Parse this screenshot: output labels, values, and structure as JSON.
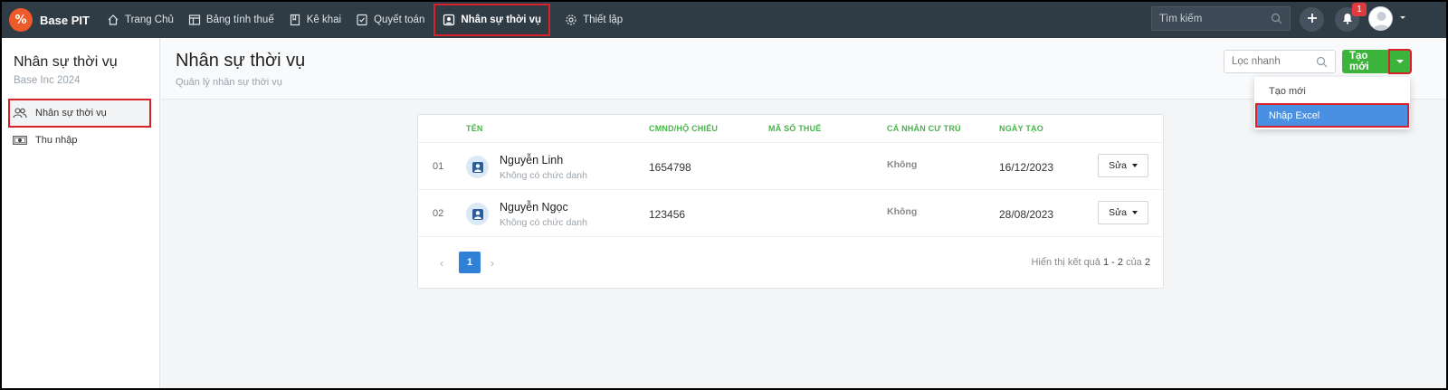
{
  "app": {
    "logo_glyph": "%",
    "name": "Base PIT",
    "brand_color": "#ef5a2a",
    "accent_green": "#3cb43c",
    "highlight_blue": "#4a90e2"
  },
  "nav": {
    "items": [
      {
        "label": "Trang Chủ",
        "icon": "home-icon"
      },
      {
        "label": "Bảng tính thuế",
        "icon": "table-icon"
      },
      {
        "label": "Kê khai",
        "icon": "book-icon"
      },
      {
        "label": "Quyết toán",
        "icon": "checklist-icon"
      },
      {
        "label": "Nhân sự thời vụ",
        "icon": "person-card-icon",
        "active": true
      },
      {
        "label": "Thiết lập",
        "icon": "gear-icon"
      }
    ],
    "search_placeholder": "Tìm kiếm",
    "notification_count": "1"
  },
  "sidebar": {
    "title": "Nhân sự thời vụ",
    "subtitle": "Base Inc 2024",
    "items": [
      {
        "label": "Nhân sự thời vụ",
        "icon": "people-icon",
        "active": true
      },
      {
        "label": "Thu nhập",
        "icon": "money-icon"
      }
    ]
  },
  "header": {
    "title": "Nhân sự thời vụ",
    "subtitle": "Quản lý nhân sự thời vụ",
    "filter_placeholder": "Lọc nhanh",
    "create_label": "Tạo mới"
  },
  "dropdown": {
    "items": [
      "Tạo mới",
      "Nhập Excel"
    ],
    "highlighted": "Nhập Excel"
  },
  "table": {
    "columns": [
      "TÊN",
      "CMND/HỘ CHIẾU",
      "MÃ SỐ THUẾ",
      "CÁ NHÂN CƯ TRÚ",
      "NGÀY TẠO"
    ],
    "rows": [
      {
        "num": "01",
        "name": "Nguyễn Linh",
        "role": "Không có chức danh",
        "id_number": "1654798",
        "tax_code": "",
        "resident": "Không",
        "created": "16/12/2023",
        "action": "Sửa"
      },
      {
        "num": "02",
        "name": "Nguyễn Ngọc",
        "role": "Không có chức danh",
        "id_number": "123456",
        "tax_code": "",
        "resident": "Không",
        "created": "28/08/2023",
        "action": "Sửa"
      }
    ]
  },
  "pagination": {
    "prev": "‹",
    "current": "1",
    "next": "›",
    "info_prefix": "Hiển thị kết quả",
    "range": "1 - 2",
    "of": "của",
    "total": "2"
  }
}
